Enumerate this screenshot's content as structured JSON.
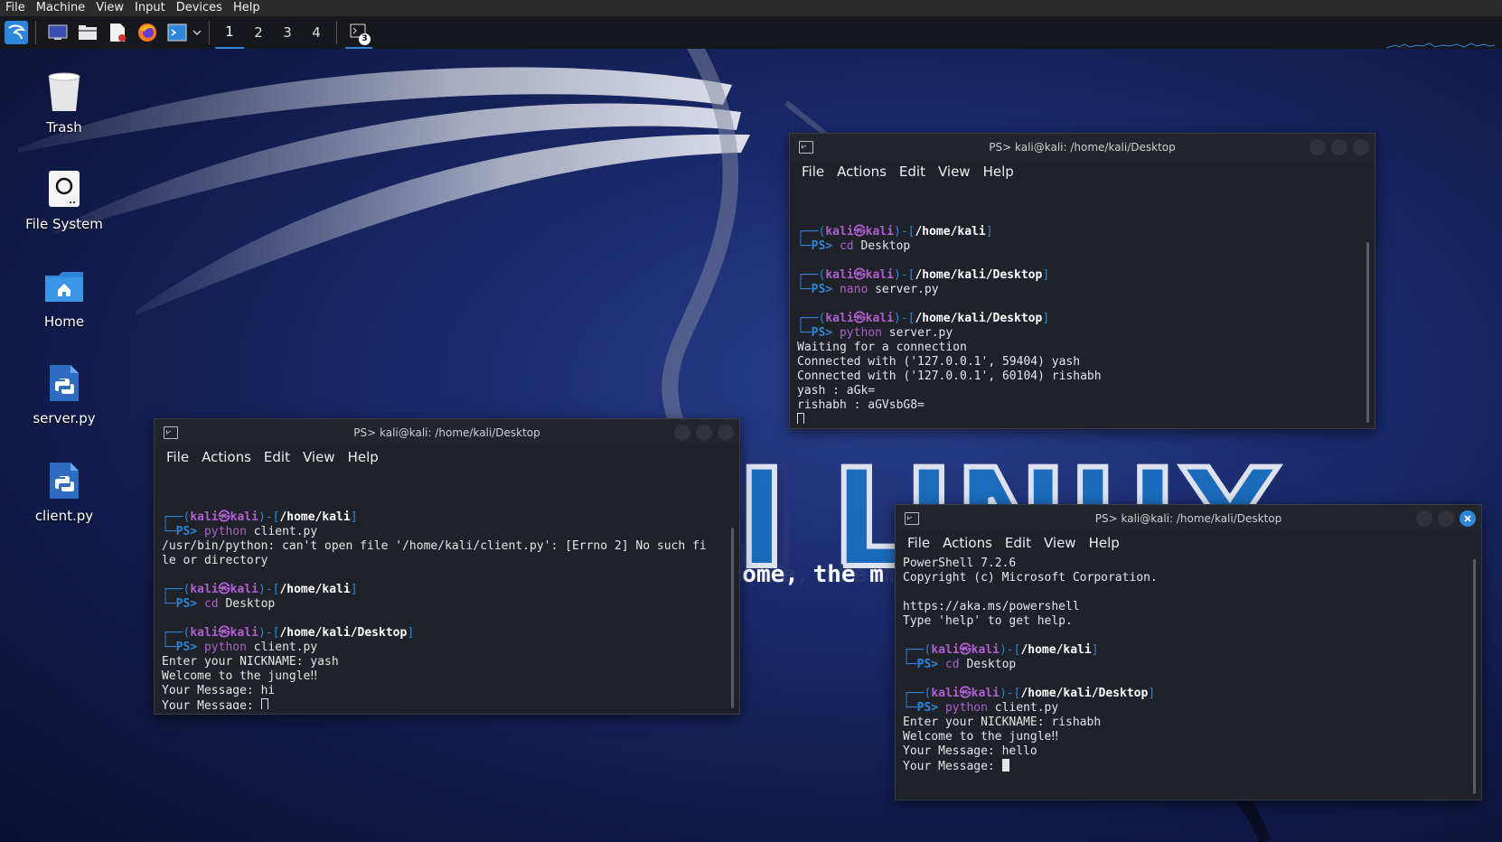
{
  "vbox_menu": [
    "File",
    "Machine",
    "View",
    "Input",
    "Devices",
    "Help"
  ],
  "workspaces": [
    "1",
    "2",
    "3",
    "4"
  ],
  "taskbar_badge": "3",
  "desktop_icons": [
    {
      "label": "Trash",
      "icon": "trash-icon"
    },
    {
      "label": "File System",
      "icon": "drive-icon"
    },
    {
      "label": "Home",
      "icon": "home-folder-icon"
    },
    {
      "label": "server.py",
      "icon": "python-file-icon"
    },
    {
      "label": "client.py",
      "icon": "python-file-icon"
    }
  ],
  "wallpaper": {
    "brand": "KALI LINUX",
    "tagline": "\"the quieter you become, the more you are able to hear\""
  },
  "colors": {
    "accent": "#2d86d9",
    "prompt_user": "#b05fd3",
    "terminal_bg": "#1f2229"
  },
  "terminal_menu": [
    "File",
    "Actions",
    "Edit",
    "View",
    "Help"
  ],
  "windows": {
    "server": {
      "title": "PS> kali@kali: /home/kali/Desktop",
      "blocks": [
        {
          "dir": "/home/kali",
          "cmd": "cd",
          "arg": " Desktop",
          "out": []
        },
        {
          "dir": "/home/kali/Desktop",
          "cmd": "nano",
          "arg": " server.py",
          "out": []
        },
        {
          "dir": "/home/kali/Desktop",
          "cmd": "python",
          "arg": " server.py",
          "out": [
            "Waiting for a connection",
            "Connected with ('127.0.0.1', 59404) yash",
            "Connected with ('127.0.0.1', 60104) rishabh",
            "yash : aGk=",
            "rishabh : aGVsbG8="
          ]
        }
      ]
    },
    "client_yash": {
      "title": "PS> kali@kali: /home/kali/Desktop",
      "blocks": [
        {
          "dir": "/home/kali",
          "cmd": "python",
          "arg": " client.py",
          "out": [
            "/usr/bin/python: can't open file '/home/kali/client.py': [Errno 2] No such fi",
            "le or directory"
          ]
        },
        {
          "dir": "/home/kali",
          "cmd": "cd",
          "arg": " Desktop",
          "out": []
        },
        {
          "dir": "/home/kali/Desktop",
          "cmd": "python",
          "arg": " client.py",
          "out": [
            "Enter your NICKNAME: yash",
            "Welcome to the jungle‼",
            "Your Message: hi"
          ]
        }
      ],
      "last_line": "Your Message: "
    },
    "client_rishabh": {
      "title": "PS> kali@kali: /home/kali/Desktop",
      "header": [
        "PowerShell 7.2.6",
        "Copyright (c) Microsoft Corporation.",
        "",
        "https://aka.ms/powershell",
        "Type 'help' to get help."
      ],
      "blocks": [
        {
          "dir": "/home/kali",
          "cmd": "cd",
          "arg": " Desktop",
          "out": []
        },
        {
          "dir": "/home/kali/Desktop",
          "cmd": "python",
          "arg": " client.py",
          "out": [
            "Enter your NICKNAME: rishabh",
            "Welcome to the jungle‼",
            "Your Message: hello"
          ]
        }
      ],
      "last_line": "Your Message: "
    }
  },
  "prompt": {
    "open": "┌──(",
    "user": "kali",
    "at": "㉿",
    "host": "kali",
    "mid": ")-[",
    "close": "]",
    "ps_prefix": "└─",
    "ps": "PS> "
  }
}
